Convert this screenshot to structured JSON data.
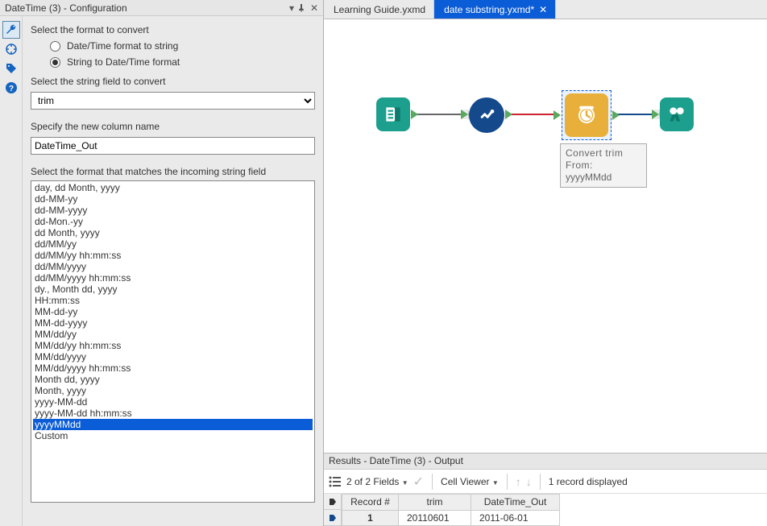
{
  "leftPanel": {
    "title": "DateTime (3) - Configuration",
    "section1": "Select the format to convert",
    "radio1": "Date/Time format to string",
    "radio2": "String to Date/Time format",
    "section2": "Select the string field to convert",
    "dropdownValue": "trim",
    "section3": "Specify the new column name",
    "columnName": "DateTime_Out",
    "section4": "Select the format that matches the incoming string field",
    "formats": [
      "day, dd Month, yyyy",
      "dd-MM-yy",
      "dd-MM-yyyy",
      "dd-Mon.-yy",
      "dd Month, yyyy",
      "dd/MM/yy",
      "dd/MM/yy hh:mm:ss",
      "dd/MM/yyyy",
      "dd/MM/yyyy hh:mm:ss",
      "dy., Month dd, yyyy",
      "HH:mm:ss",
      "MM-dd-yy",
      "MM-dd-yyyy",
      "MM/dd/yy",
      "MM/dd/yy hh:mm:ss",
      "MM/dd/yyyy",
      "MM/dd/yyyy hh:mm:ss",
      "Month dd, yyyy",
      "Month, yyyy",
      "yyyy-MM-dd",
      "yyyy-MM-dd hh:mm:ss",
      "yyyyMMdd",
      "Custom"
    ],
    "selectedFormatIndex": 21
  },
  "tabs": {
    "inactive": "Learning Guide.yxmd",
    "active": "date substring.yxmd*"
  },
  "annotation": {
    "line1": "Convert trim From:",
    "line2": "yyyyMMdd"
  },
  "results": {
    "title": "Results - DateTime (3) - Output",
    "fieldsSummary": "2 of 2 Fields",
    "cellViewer": "Cell Viewer",
    "recordsSummary": "1 record displayed",
    "headers": {
      "rec": "Record #",
      "c1": "trim",
      "c2": "DateTime_Out"
    },
    "row": {
      "rec": "1",
      "c1": "20110601",
      "c2": "2011-06-01"
    }
  }
}
